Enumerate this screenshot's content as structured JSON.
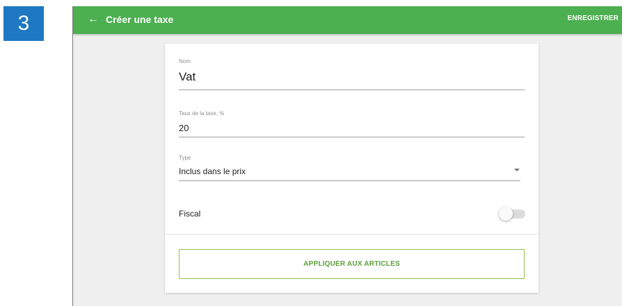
{
  "step_badge": "3",
  "appbar": {
    "back_icon": "←",
    "title": "Créer une taxe",
    "save_label": "ENREGISTRER"
  },
  "form": {
    "name": {
      "label": "Nom",
      "value": "Vat"
    },
    "rate": {
      "label": "Taux de la taxe, %",
      "value": "20"
    },
    "type": {
      "label": "Type",
      "value": "Inclus dans le prix"
    },
    "fiscal": {
      "label": "Fiscal",
      "enabled": false
    },
    "apply_label": "APPLIQUER AUX ARTICLES"
  },
  "colors": {
    "appbar": "#4caf50",
    "badge": "#1e78c2",
    "accent_button": "#8bc34a"
  },
  "icons": {
    "back": "arrow-left-icon",
    "dropdown": "caret-down-icon"
  }
}
